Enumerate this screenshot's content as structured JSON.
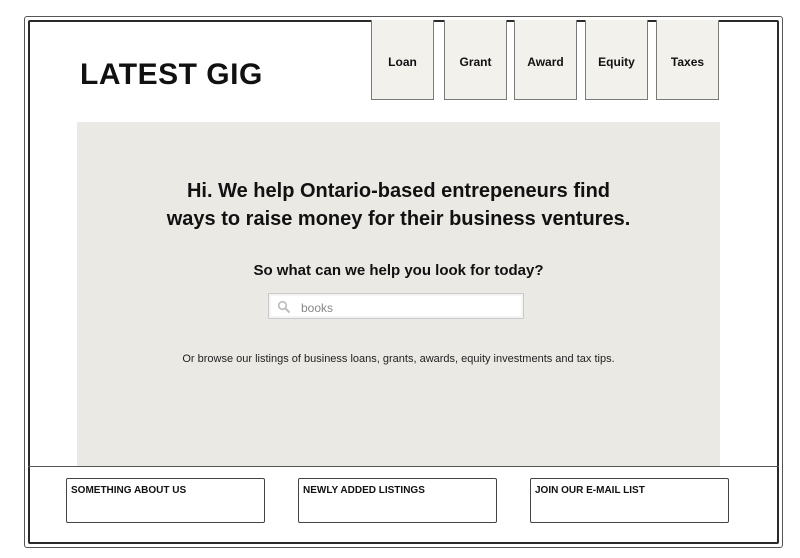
{
  "brand": {
    "logo_text": "LATEST GIG"
  },
  "nav": {
    "tabs": [
      {
        "label": "Loan"
      },
      {
        "label": "Grant"
      },
      {
        "label": "Award"
      },
      {
        "label": "Equity"
      },
      {
        "label": "Taxes"
      }
    ]
  },
  "hero": {
    "headline_line1": "Hi. We help Ontario-based entrepeneurs find",
    "headline_line2": "ways to raise money for their business ventures.",
    "subheading": "So what can we help you look for today?",
    "search": {
      "value": "books",
      "icon": "search-icon"
    },
    "browse_text": "Or browse our listings of business loans, grants, awards, equity investments and tax tips."
  },
  "footer": {
    "boxes": [
      {
        "title": "SOMETHING ABOUT US"
      },
      {
        "title": "NEWLY ADDED LISTINGS"
      },
      {
        "title": "JOIN OUR E-MAIL LIST"
      }
    ]
  },
  "colors": {
    "hero_background": "#ebe9e4",
    "tab_background": "#f2f1ec",
    "text": "#111111"
  }
}
